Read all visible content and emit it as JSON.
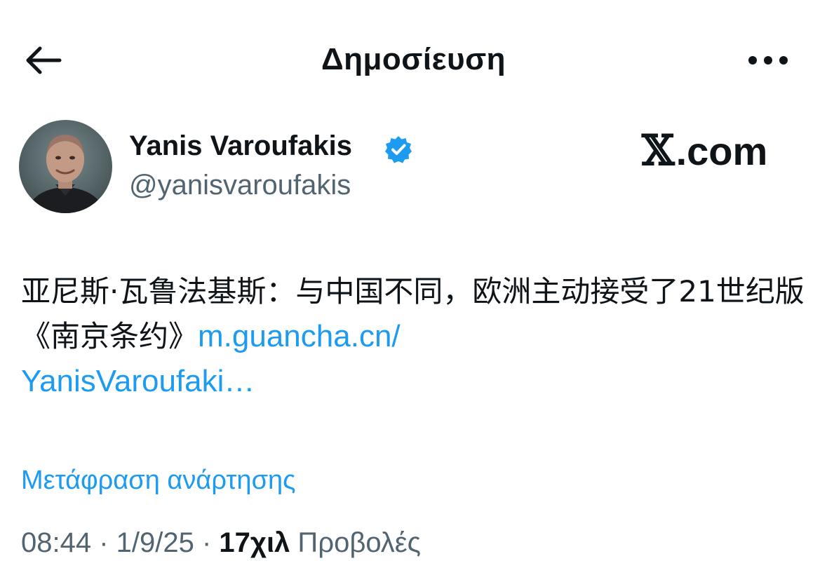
{
  "header": {
    "title": "Δημοσίευση",
    "back_icon": "arrow-left-icon",
    "more_icon": "more-horizontal-icon"
  },
  "author": {
    "name": "Yanis Varoufakis",
    "handle": "@yanisvaroufakis",
    "verified_icon": "verified-badge-icon",
    "verified_color": "#1d9bf0"
  },
  "watermark": {
    "x": "𝕏",
    "text": ".com"
  },
  "post": {
    "text": "亚尼斯·瓦鲁法基斯：与中国不同，欧洲主动接受了21世纪版《南京条约》",
    "link_line1": "m.guancha.cn/",
    "link_line2": "YanisVaroufaki…",
    "link_color": "#1d9bf0"
  },
  "translate_label": "Μετάφραση ανάρτησης",
  "meta": {
    "time": "08:44",
    "sep1": " · ",
    "date": "1/9/25",
    "sep2": " · ",
    "views_count": "17χιλ",
    "views_label": " Προβολές"
  }
}
